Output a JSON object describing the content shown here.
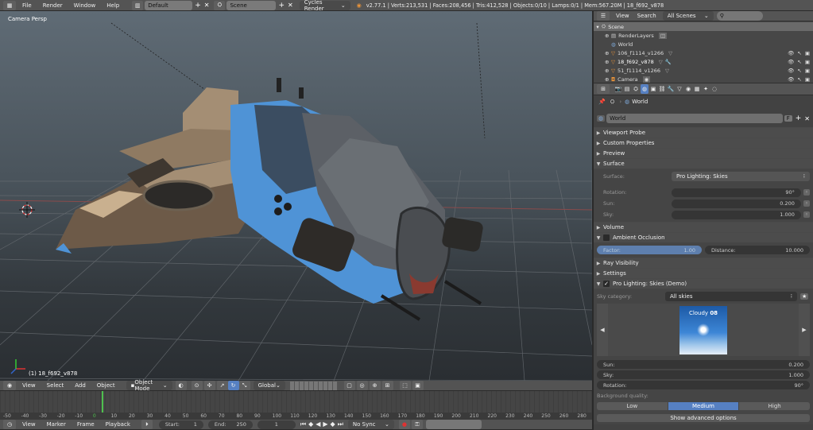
{
  "top_menu": {
    "items": [
      "File",
      "Render",
      "Window",
      "Help"
    ],
    "screen_layout": "Default",
    "scene_name": "Scene",
    "render_engine": "Cycles Render",
    "stats": "v2.77.1 | Verts:213,531 | Faces:208,456 | Tris:412,528 | Objects:0/10 | Lamps:0/1 | Mem:567.20M | 18_f692_v878"
  },
  "viewport": {
    "title": "Camera Persp",
    "object_label": "(1) 18_f692_v878"
  },
  "viewport_header": {
    "items": [
      "View",
      "Select",
      "Add",
      "Object"
    ],
    "mode": "Object Mode",
    "orientation": "Global"
  },
  "timeline": {
    "ticks": [
      "-50",
      "-40",
      "-30",
      "-20",
      "-10",
      "0",
      "10",
      "20",
      "30",
      "40",
      "50",
      "60",
      "70",
      "80",
      "90",
      "100",
      "110",
      "120",
      "130",
      "140",
      "150",
      "160",
      "170",
      "180",
      "190",
      "200",
      "210",
      "220",
      "230",
      "240",
      "250",
      "260",
      "280"
    ],
    "current_frame_marker": "0"
  },
  "timeline_header": {
    "items": [
      "View",
      "Marker",
      "Frame",
      "Playback"
    ],
    "start_label": "Start:",
    "start_value": "1",
    "end_label": "End:",
    "end_value": "250",
    "current_frame": "1",
    "sync": "No Sync"
  },
  "outliner": {
    "menu": [
      "View",
      "Search"
    ],
    "filter": "All Scenes",
    "rows": [
      {
        "label": "Scene",
        "icon": "scene-icon"
      },
      {
        "label": "RenderLayers",
        "icon": "renderlayers-icon"
      },
      {
        "label": "World",
        "icon": "world-icon"
      },
      {
        "label": "106_f1114_v1266",
        "icon": "mesh-icon"
      },
      {
        "label": "18_f692_v878",
        "icon": "mesh-icon"
      },
      {
        "label": "51_f1114_v1266",
        "icon": "mesh-icon"
      },
      {
        "label": "Camera",
        "icon": "camera-icon"
      }
    ]
  },
  "properties": {
    "context": "World",
    "world_name": "World",
    "world_users": "F",
    "panels": {
      "viewport_probe": "Viewport Probe",
      "custom_properties": "Custom Properties",
      "preview": "Preview",
      "surface": "Surface",
      "volume": "Volume",
      "ambient_occlusion": "Ambient Occlusion",
      "ray_visibility": "Ray Visibility",
      "settings": "Settings",
      "pro_lighting": "Pro Lighting: Skies (Demo)"
    },
    "surface": {
      "label": "Surface:",
      "value": "Pro Lighting: Skies",
      "rotation_label": "Rotation:",
      "rotation_value": "90°",
      "sun_label": "Sun:",
      "sun_value": "0.200",
      "sky_label": "Sky:",
      "sky_value": "1.000"
    },
    "ao": {
      "factor_label": "Factor:",
      "factor_value": "1.00",
      "distance_label": "Distance:",
      "distance_value": "10.000"
    },
    "pro_lighting": {
      "category_label": "Sky category:",
      "category_value": "All skies",
      "thumb_title": "Cloudy",
      "thumb_number": "08",
      "sun_label": "Sun:",
      "sun_value": "0.200",
      "sky_label": "Sky:",
      "sky_value": "1.000",
      "rotation_label": "Rotation:",
      "rotation_value": "90°",
      "quality_label": "Background quality:",
      "quality_options": [
        "Low",
        "Medium",
        "High"
      ],
      "quality_selected": "Medium",
      "advanced_button": "Show advanced options"
    }
  },
  "colors": {
    "accent_blue": "#5680c2",
    "timeline_current": "#4fc04f",
    "viewport_bg_top": "#5e6a74",
    "viewport_bg_bottom": "#2b2f33"
  }
}
